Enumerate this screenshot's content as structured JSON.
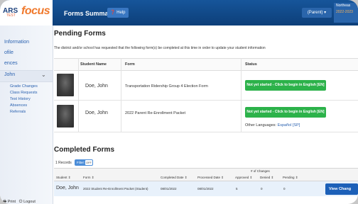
{
  "app": {
    "logo_left": "ARS",
    "logo_sub": "TEST",
    "logo_right": "focus",
    "title": "Forms Summary",
    "help_label": "Help",
    "role_label": "(Parent) ▾",
    "school_name": "Northeas",
    "school_year": "2022-2023"
  },
  "sidebar": {
    "items": [
      "Information",
      "ofile",
      "ences",
      "John"
    ],
    "sub_items": [
      "Grade Changes",
      "Class Requests",
      "Test History",
      "Absences",
      "Referrals"
    ],
    "footer_print": "Print",
    "footer_logout": "Logout"
  },
  "pending": {
    "heading": "Pending Forms",
    "description": "The district and/or school has requested that the following form(s) be completed at this time in order to update your student information",
    "columns": [
      "Student Name",
      "Form",
      "Status"
    ],
    "rows": [
      {
        "student": "Doe, John",
        "form": "Transportation Ridership Group 4 Election Form",
        "status_button": "Not yet started - Click to begin in English [EN]"
      },
      {
        "student": "Doe, John",
        "form": "2022 Parent Re-Enrollment Packet",
        "status_button": "Not yet started - Click to begin in English [EN]",
        "other_languages_label": "Other Languages:",
        "other_languages_link": "Español [SP]"
      }
    ]
  },
  "completed": {
    "heading": "Completed Forms",
    "records": "1 Records",
    "filter_label": "Filter:",
    "filter_state": "OFF",
    "group_header": "# of Changes",
    "columns": [
      "Student ⇕",
      "Form ⇕",
      "Completed Date ⇕",
      "Processed Date ⇕",
      "Approved ⇕",
      "Denied ⇕",
      "Pending ⇕"
    ],
    "row": {
      "student": "Doe, John",
      "form": "2022 Student Re-Enrollment Packet (Student)",
      "completed_date": "08/01/2022",
      "processed_date": "08/01/2022",
      "approved": "5",
      "denied": "0",
      "pending": "0"
    },
    "view_button": "View Chang"
  }
}
